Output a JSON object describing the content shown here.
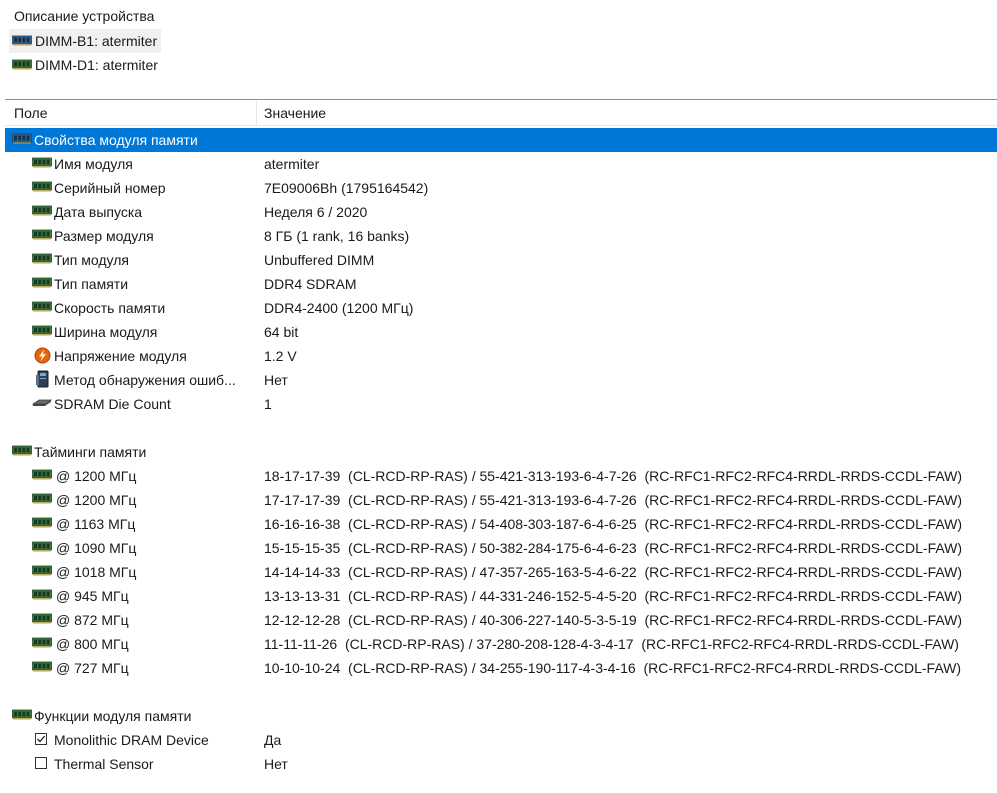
{
  "device_pane": {
    "title": "Описание устройства",
    "devices": [
      {
        "label": "DIMM-B1: atermiter",
        "icon": "memory-module-icon"
      },
      {
        "label": "DIMM-D1: atermiter",
        "icon": "memory-module-icon"
      }
    ]
  },
  "grid": {
    "columns": {
      "field": "Поле",
      "value": "Значение"
    },
    "sections": {
      "props": "Свойства модуля памяти",
      "timings": "Тайминги памяти",
      "features": "Функции модуля памяти"
    },
    "props_rows": [
      {
        "field": "Имя модуля",
        "value": "atermiter",
        "icon": "memory-module-icon"
      },
      {
        "field": "Серийный номер",
        "value": "7E09006Bh (1795164542)",
        "icon": "memory-module-icon"
      },
      {
        "field": "Дата выпуска",
        "value": "Неделя 6 / 2020",
        "icon": "memory-module-icon"
      },
      {
        "field": "Размер модуля",
        "value": "8 ГБ (1 rank, 16 banks)",
        "icon": "memory-module-icon"
      },
      {
        "field": "Тип модуля",
        "value": "Unbuffered DIMM",
        "icon": "memory-module-icon"
      },
      {
        "field": "Тип памяти",
        "value": "DDR4 SDRAM",
        "icon": "memory-module-icon"
      },
      {
        "field": "Скорость памяти",
        "value": "DDR4-2400 (1200 МГц)",
        "icon": "memory-module-icon"
      },
      {
        "field": "Ширина модуля",
        "value": "64 bit",
        "icon": "memory-module-icon"
      },
      {
        "field": "Напряжение модуля",
        "value": "1.2 V",
        "icon": "voltage-icon"
      },
      {
        "field": "Метод обнаружения ошиб...",
        "value": "Нет",
        "icon": "device-icon"
      },
      {
        "field": "SDRAM Die Count",
        "value": "1",
        "icon": "chip-icon"
      }
    ],
    "timing_rows": [
      {
        "field": "@ 1200 МГц",
        "value": "18-17-17-39  (CL-RCD-RP-RAS) / 55-421-313-193-6-4-7-26  (RC-RFC1-RFC2-RFC4-RRDL-RRDS-CCDL-FAW)"
      },
      {
        "field": "@ 1200 МГц",
        "value": "17-17-17-39  (CL-RCD-RP-RAS) / 55-421-313-193-6-4-7-26  (RC-RFC1-RFC2-RFC4-RRDL-RRDS-CCDL-FAW)"
      },
      {
        "field": "@ 1163 МГц",
        "value": "16-16-16-38  (CL-RCD-RP-RAS) / 54-408-303-187-6-4-6-25  (RC-RFC1-RFC2-RFC4-RRDL-RRDS-CCDL-FAW)"
      },
      {
        "field": "@ 1090 МГц",
        "value": "15-15-15-35  (CL-RCD-RP-RAS) / 50-382-284-175-6-4-6-23  (RC-RFC1-RFC2-RFC4-RRDL-RRDS-CCDL-FAW)"
      },
      {
        "field": "@ 1018 МГц",
        "value": "14-14-14-33  (CL-RCD-RP-RAS) / 47-357-265-163-5-4-6-22  (RC-RFC1-RFC2-RFC4-RRDL-RRDS-CCDL-FAW)"
      },
      {
        "field": "@ 945 МГц",
        "value": "13-13-13-31  (CL-RCD-RP-RAS) / 44-331-246-152-5-4-5-20  (RC-RFC1-RFC2-RFC4-RRDL-RRDS-CCDL-FAW)"
      },
      {
        "field": "@ 872 МГц",
        "value": "12-12-12-28  (CL-RCD-RP-RAS) / 40-306-227-140-5-3-5-19  (RC-RFC1-RFC2-RFC4-RRDL-RRDS-CCDL-FAW)"
      },
      {
        "field": "@ 800 МГц",
        "value": "11-11-11-26  (CL-RCD-RP-RAS) / 37-280-208-128-4-3-4-17  (RC-RFC1-RFC2-RFC4-RRDL-RRDS-CCDL-FAW)"
      },
      {
        "field": "@ 727 МГц",
        "value": "10-10-10-24  (CL-RCD-RP-RAS) / 34-255-190-117-4-3-4-16  (RC-RFC1-RFC2-RFC4-RRDL-RRDS-CCDL-FAW)"
      }
    ],
    "feature_rows": [
      {
        "field": "Monolithic DRAM Device",
        "value": "Да",
        "checked": true
      },
      {
        "field": "Thermal Sensor",
        "value": "Нет",
        "checked": false
      }
    ]
  },
  "colors": {
    "selection": "#0078d7",
    "ram_green": "#2f6b32"
  }
}
